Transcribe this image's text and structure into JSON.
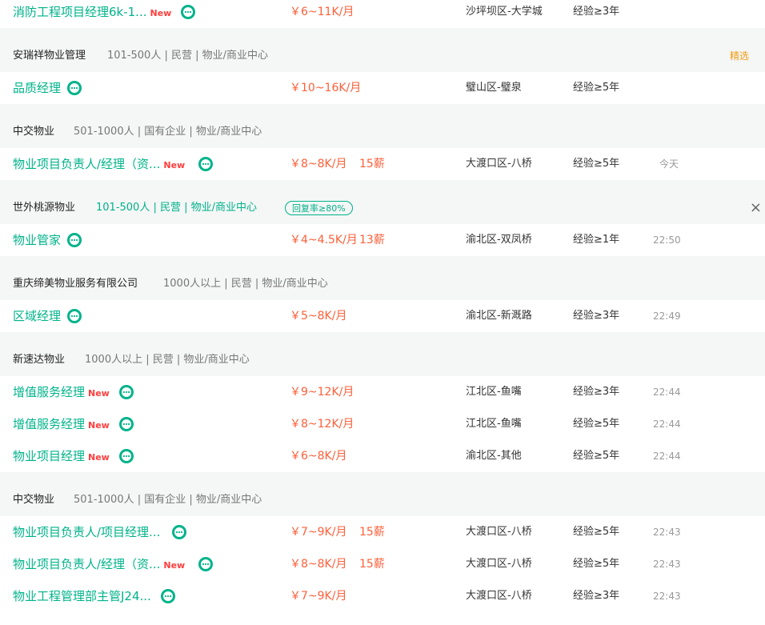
{
  "groups": [
    {
      "company": null,
      "jobs": [
        {
          "title": "消防工程项目经理6k-1...",
          "new": "New",
          "salary": "￥6~11K/月",
          "bonus": "",
          "location": "沙坪坝区-大学城",
          "exp": "经验≥3年",
          "time": ""
        }
      ]
    },
    {
      "company": {
        "name": "安瑞祥物业管理",
        "meta": "101-500人 | 民营 | 物业/商业中心",
        "featured": "精选"
      },
      "jobs": [
        {
          "title": "品质经理",
          "new": "",
          "salary": "￥10~16K/月",
          "bonus": "",
          "location": "璧山区-璧泉",
          "exp": "经验≥5年",
          "time": ""
        }
      ]
    },
    {
      "company": {
        "name": "中交物业",
        "meta": "501-1000人 | 国有企业 | 物业/商业中心"
      },
      "jobs": [
        {
          "title": "物业项目负责人/经理（资...",
          "new": "New",
          "salary": "￥8~8K/月",
          "bonus": "15薪",
          "location": "大渡口区-八桥",
          "exp": "经验≥5年",
          "time": "今天"
        }
      ]
    },
    {
      "company": {
        "name": "世外桃源物业",
        "meta": "101-500人 | 民营 | 物业/商业中心",
        "badge": "回复率≥80%",
        "close": "×"
      },
      "jobs": [
        {
          "title": "物业管家",
          "new": "",
          "salary": "￥4~4.5K/月",
          "bonus": "13薪",
          "location": "渝北区-双凤桥",
          "exp": "经验≥1年",
          "time": "22:50"
        }
      ]
    },
    {
      "company": {
        "name": "重庆缔美物业服务有限公司",
        "meta": "1000人以上 | 民营 | 物业/商业中心"
      },
      "jobs": [
        {
          "title": "区域经理",
          "new": "",
          "salary": "￥5~8K/月",
          "bonus": "",
          "location": "渝北区-新溉路",
          "exp": "经验≥3年",
          "time": "22:49"
        }
      ]
    },
    {
      "company": {
        "name": "新速达物业",
        "meta": "1000人以上 | 民营 | 物业/商业中心"
      },
      "jobs": [
        {
          "title": "增值服务经理",
          "new": "New",
          "salary": "￥9~12K/月",
          "bonus": "",
          "location": "江北区-鱼嘴",
          "exp": "经验≥3年",
          "time": "22:44"
        },
        {
          "title": "增值服务经理",
          "new": "New",
          "salary": "￥8~12K/月",
          "bonus": "",
          "location": "江北区-鱼嘴",
          "exp": "经验≥5年",
          "time": "22:44"
        },
        {
          "title": "物业项目经理",
          "new": "New",
          "salary": "￥6~8K/月",
          "bonus": "",
          "location": "渝北区-其他",
          "exp": "经验≥5年",
          "time": "22:44"
        }
      ]
    },
    {
      "company": {
        "name": "中交物业",
        "meta": "501-1000人 | 国有企业 | 物业/商业中心"
      },
      "jobs": [
        {
          "title": "物业项目负责人/项目经理...",
          "new": "",
          "salary": "￥7~9K/月",
          "bonus": "15薪",
          "location": "大渡口区-八桥",
          "exp": "经验≥5年",
          "time": "22:43"
        },
        {
          "title": "物业项目负责人/经理（资...",
          "new": "New",
          "salary": "￥8~8K/月",
          "bonus": "15薪",
          "location": "大渡口区-八桥",
          "exp": "经验≥5年",
          "time": "22:43"
        },
        {
          "title": "物业工程管理部主管J24...",
          "new": "",
          "salary": "￥7~9K/月",
          "bonus": "",
          "location": "大渡口区-八桥",
          "exp": "经验≥3年",
          "time": "22:43"
        }
      ]
    }
  ]
}
